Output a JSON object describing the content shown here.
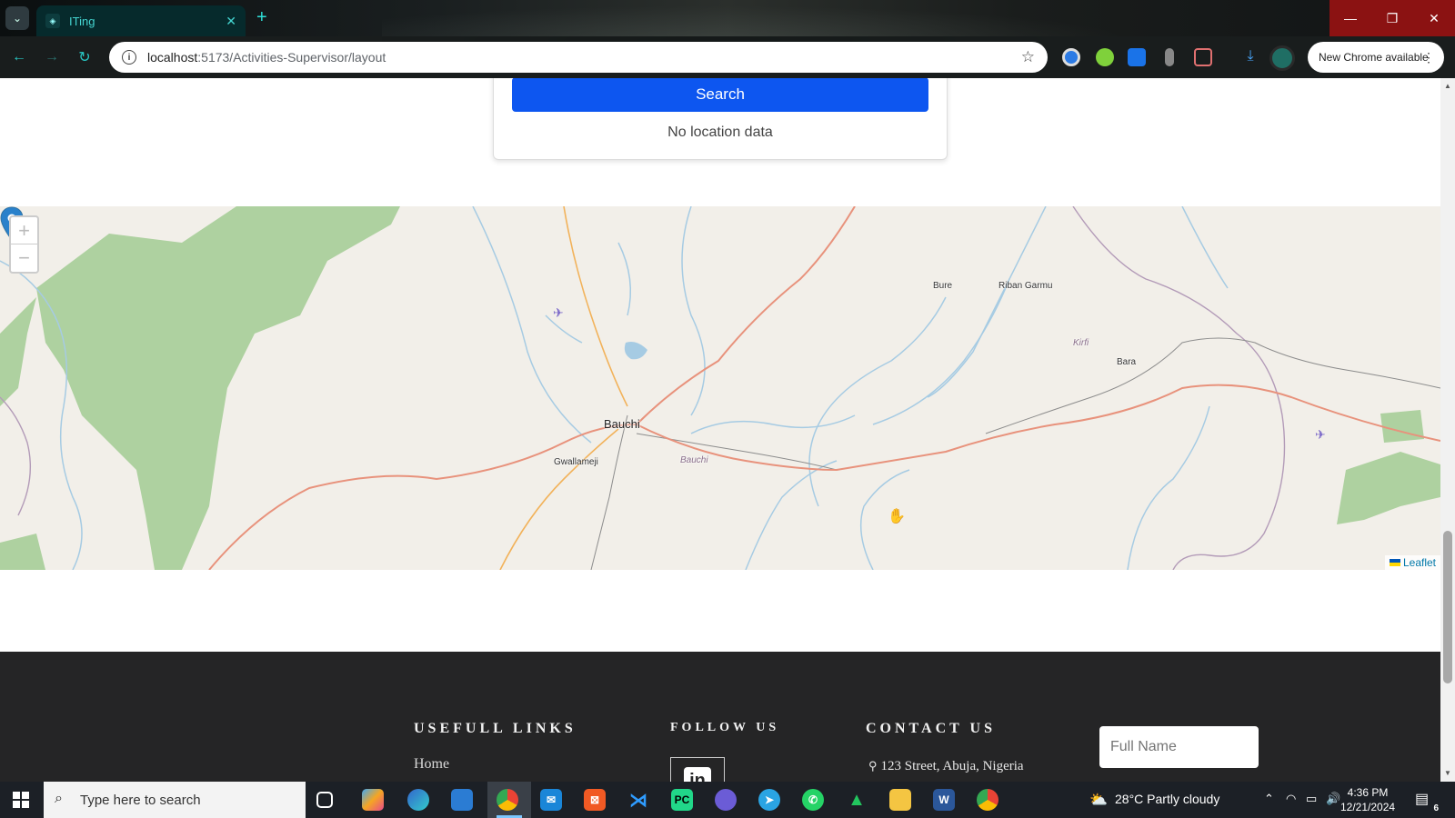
{
  "browser": {
    "tab_title": "ITing",
    "url_host": "localhost",
    "url_path": ":5173/Activities-Supervisor/layout",
    "new_chrome_label": "New Chrome available"
  },
  "search_panel": {
    "search_label": "Search",
    "status_text": "No location data"
  },
  "map": {
    "attribution": "Leaflet",
    "zoom_in": "+",
    "zoom_out": "−",
    "labels": {
      "bauchi_city": "Bauchi",
      "gwallameji": "Gwallameji",
      "bauchi_lga": "Bauchi",
      "bure": "Bure",
      "riban_garmu": "Riban Garmu",
      "kirfi": "Kirfi",
      "bara": "Bara"
    },
    "colors": {
      "park": "#aed1a0",
      "water": "#a6cbe3",
      "road": "#e8927c",
      "land": "#f2efe9"
    }
  },
  "footer": {
    "useful_links_heading": "USEFULL LINKS",
    "follow_us_heading": "FOLLOW US",
    "contact_us_heading": "CONTACT US",
    "home_link": "Home",
    "linkedin_label": "in",
    "address": "123 Street, Abuja, Nigeria",
    "full_name_placeholder": "Full Name"
  },
  "taskbar": {
    "search_placeholder": "Type here to search",
    "weather": "28°C  Partly cloudy",
    "time": "4:36 PM",
    "date": "12/21/2024",
    "notification_count": "6"
  }
}
